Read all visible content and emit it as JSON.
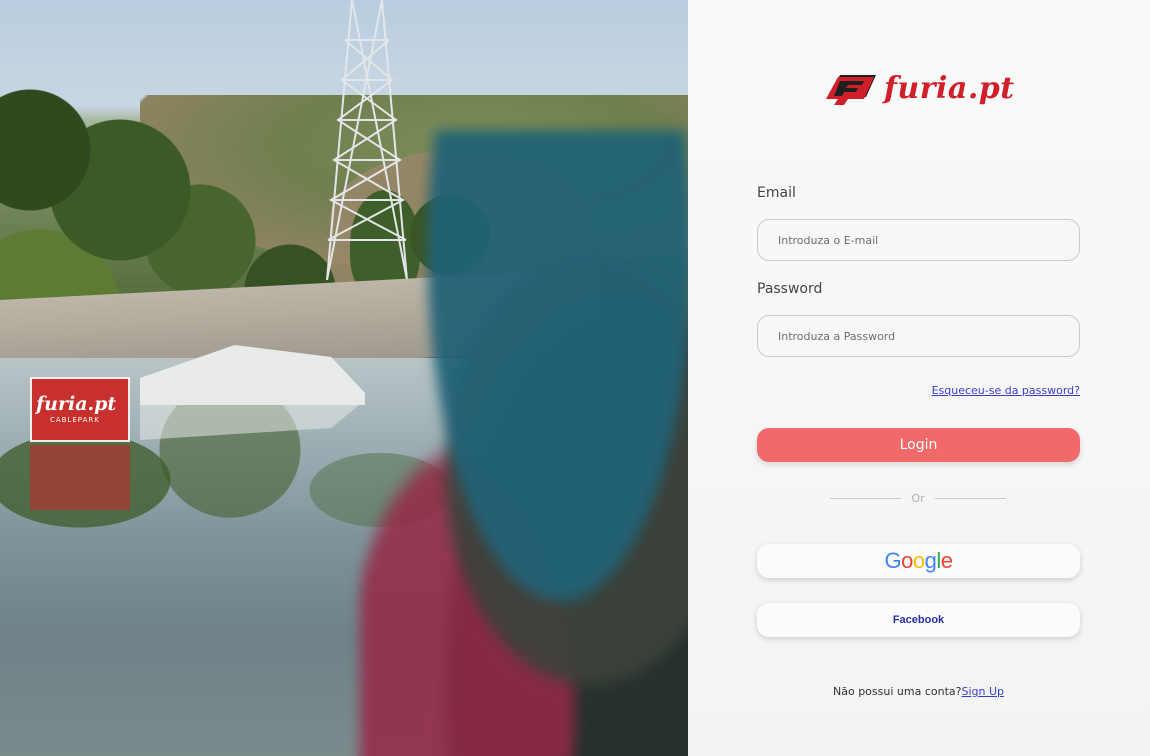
{
  "brand": {
    "logo_text": "furia.pt",
    "logo_icon": "furia-logo-icon",
    "accent_color": "#d11f2a"
  },
  "hero": {
    "banner_text": "furia.pt",
    "banner_subtext": "CABLEPARK"
  },
  "login_form": {
    "email_label": "Email",
    "email_placeholder": "Introduza o E-mail",
    "email_value": "",
    "password_label": "Password",
    "password_placeholder": "Introduza a Password",
    "password_value": "",
    "forgot_password": "Esqueceu-se da password?",
    "login_button": "Login",
    "login_button_color": "#f2696a",
    "divider_text": "Or",
    "google_button_letters": [
      "G",
      "o",
      "o",
      "g",
      "l",
      "e"
    ],
    "google_icon": "google-wordmark",
    "facebook_button": "Facebook",
    "signup_prompt": "Não possui uma conta?",
    "signup_link": "Sign Up"
  }
}
